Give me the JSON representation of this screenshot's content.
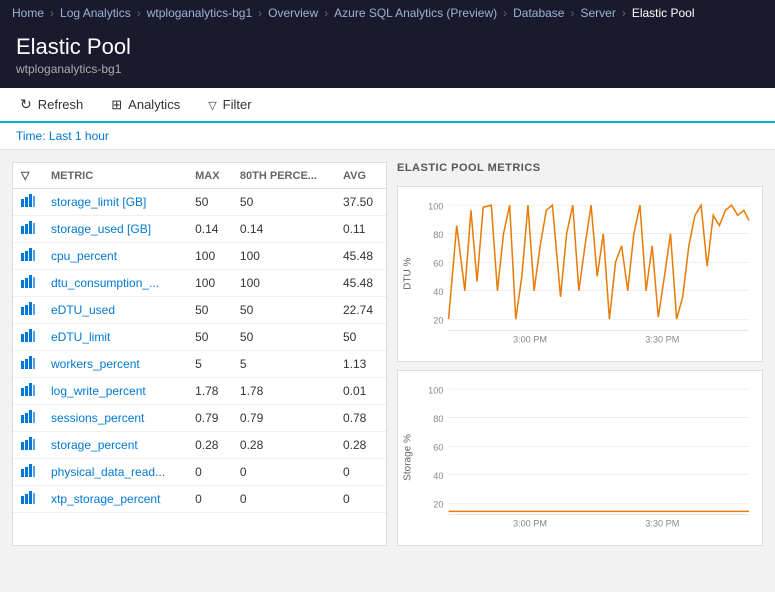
{
  "nav": {
    "items": [
      "Home",
      "Log Analytics",
      "wtploganalytics-bg1",
      "Overview",
      "Azure SQL Analytics (Preview)",
      "Database",
      "Server",
      "Elastic Pool"
    ]
  },
  "header": {
    "title": "Elastic Pool",
    "subtitle": "wtploganalytics-bg1"
  },
  "toolbar": {
    "refresh_label": "Refresh",
    "analytics_label": "Analytics",
    "filter_label": "Filter"
  },
  "time_bar": {
    "label": "Time: Last 1 hour"
  },
  "metrics": {
    "chart_title": "ELASTIC POOL METRICS",
    "columns": {
      "metric": "METRIC",
      "max": "MAX",
      "percentile": "80TH PERCE...",
      "avg": "AVG"
    },
    "rows": [
      {
        "name": "storage_limit [GB]",
        "max": "50",
        "p80": "50",
        "avg": "37.50"
      },
      {
        "name": "storage_used [GB]",
        "max": "0.14",
        "p80": "0.14",
        "avg": "0.11"
      },
      {
        "name": "cpu_percent",
        "max": "100",
        "p80": "100",
        "avg": "45.48"
      },
      {
        "name": "dtu_consumption_...",
        "max": "100",
        "p80": "100",
        "avg": "45.48"
      },
      {
        "name": "eDTU_used",
        "max": "50",
        "p80": "50",
        "avg": "22.74"
      },
      {
        "name": "eDTU_limit",
        "max": "50",
        "p80": "50",
        "avg": "50"
      },
      {
        "name": "workers_percent",
        "max": "5",
        "p80": "5",
        "avg": "1.13"
      },
      {
        "name": "log_write_percent",
        "max": "1.78",
        "p80": "1.78",
        "avg": "0.01"
      },
      {
        "name": "sessions_percent",
        "max": "0.79",
        "p80": "0.79",
        "avg": "0.78"
      },
      {
        "name": "storage_percent",
        "max": "0.28",
        "p80": "0.28",
        "avg": "0.28"
      },
      {
        "name": "physical_data_read...",
        "max": "0",
        "p80": "0",
        "avg": "0"
      },
      {
        "name": "xtp_storage_percent",
        "max": "0",
        "p80": "0",
        "avg": "0"
      }
    ]
  },
  "chart1": {
    "y_label": "DTU %",
    "y_ticks": [
      "100",
      "80",
      "60",
      "40",
      "20"
    ],
    "x_labels": [
      "3:00 PM",
      "3:30 PM"
    ]
  },
  "chart2": {
    "y_label": "Storage %",
    "y_ticks": [
      "100",
      "80",
      "60",
      "40",
      "20"
    ],
    "x_labels": [
      "3:00 PM",
      "3:30 PM"
    ]
  }
}
